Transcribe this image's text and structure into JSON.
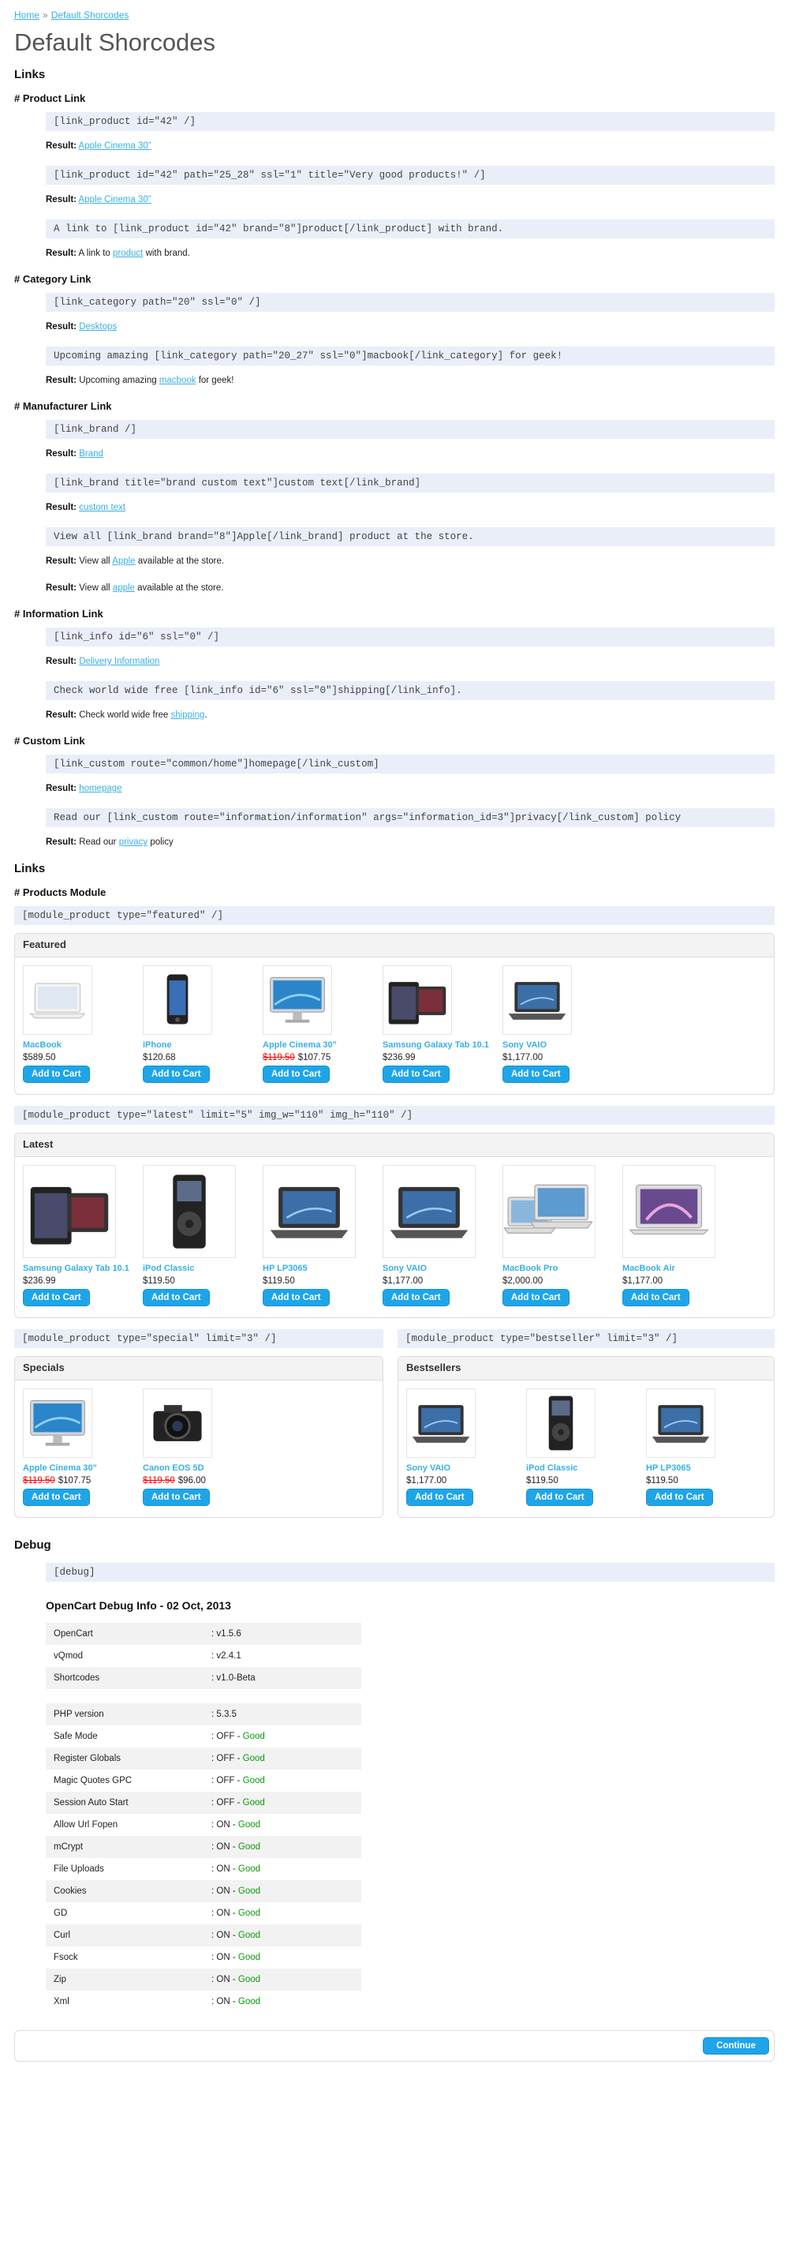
{
  "breadcrumb": {
    "home": "Home",
    "sep": "»",
    "current": "Default Shorcodes"
  },
  "title": "Default Shorcodes",
  "links_heading": "Links",
  "result_label": "Result:",
  "product_link": {
    "heading": "# Product Link",
    "ex1_code": "[link_product id=\"42\" /]",
    "ex1_link": "Apple Cinema 30\"",
    "ex2_code": "[link_product id=\"42\" path=\"25_28\" ssl=\"1\" title=\"Very good products!\" /]",
    "ex2_link": "Apple Cinema 30\"",
    "ex3_code": "A link to [link_product id=\"42\" brand=\"8\"]product[/link_product] with brand.",
    "ex3_pre": "A link to ",
    "ex3_link": "product",
    "ex3_post": " with brand."
  },
  "category_link": {
    "heading": "# Category Link",
    "ex1_code": "[link_category path=\"20\" ssl=\"0\" /]",
    "ex1_link": "Desktops",
    "ex2_code": "Upcoming amazing [link_category path=\"20_27\" ssl=\"0\"]macbook[/link_category] for geek!",
    "ex2_pre": "Upcoming amazing ",
    "ex2_link": "macbook",
    "ex2_post": " for geek!"
  },
  "manufacturer_link": {
    "heading": "# Manufacturer Link",
    "ex1_code": "[link_brand /]",
    "ex1_link": "Brand",
    "ex2_code": "[link_brand title=\"brand custom text\"]custom text[/link_brand]",
    "ex2_link": "custom text",
    "ex3_code": "View all [link_brand brand=\"8\"]Apple[/link_brand] product at the store.",
    "ex3_pre": "View all ",
    "ex3_link": "Apple",
    "ex3_post": " available at the store.",
    "ex4_pre": "View all ",
    "ex4_link": "apple",
    "ex4_post": " available at the store."
  },
  "information_link": {
    "heading": "# Information Link",
    "ex1_code": "[link_info id=\"6\" ssl=\"0\" /]",
    "ex1_link": "Delivery Information",
    "ex2_code": "Check world wide free [link_info id=\"6\" ssl=\"0\"]shipping[/link_info].",
    "ex2_pre": "Check world wide free ",
    "ex2_link": "shipping",
    "ex2_post": "."
  },
  "custom_link": {
    "heading": "# Custom Link",
    "ex1_code": "[link_custom route=\"common/home\"]homepage[/link_custom]",
    "ex1_link": "homepage",
    "ex2_code": "Read our [link_custom route=\"information/information\" args=\"information_id=3\"]privacy[/link_custom] policy",
    "ex2_pre": "Read our ",
    "ex2_link": "privacy",
    "ex2_post": " policy"
  },
  "links2_heading": "Links",
  "products_module_heading": "# Products Module",
  "add_to_cart": "Add to Cart",
  "featured": {
    "code": "[module_product type=\"featured\" /]",
    "title": "Featured",
    "products": [
      {
        "name": "MacBook",
        "price": "$589.50",
        "old": "",
        "icon": "laptop-white"
      },
      {
        "name": "iPhone",
        "price": "$120.68",
        "old": "",
        "icon": "phone"
      },
      {
        "name": "Apple Cinema 30\"",
        "price": "$107.75",
        "old": "$119.50",
        "icon": "monitor"
      },
      {
        "name": "Samsung Galaxy Tab 10.1",
        "price": "$236.99",
        "old": "",
        "icon": "tablet"
      },
      {
        "name": "Sony VAIO",
        "price": "$1,177.00",
        "old": "",
        "icon": "laptop-dark"
      }
    ]
  },
  "latest": {
    "code": "[module_product type=\"latest\" limit=\"5\" img_w=\"110\" img_h=\"110\" /]",
    "title": "Latest",
    "products": [
      {
        "name": "Samsung Galaxy Tab 10.1",
        "price": "$236.99",
        "old": "",
        "icon": "tablet"
      },
      {
        "name": "iPod Classic",
        "price": "$119.50",
        "old": "",
        "icon": "ipod"
      },
      {
        "name": "HP LP3065",
        "price": "$119.50",
        "old": "",
        "icon": "laptop-dark"
      },
      {
        "name": "Sony VAIO",
        "price": "$1,177.00",
        "old": "",
        "icon": "laptop-dark"
      },
      {
        "name": "MacBook Pro",
        "price": "$2,000.00",
        "old": "",
        "icon": "laptop-multi"
      },
      {
        "name": "MacBook Air",
        "price": "$1,177.00",
        "old": "",
        "icon": "laptop-air"
      }
    ]
  },
  "specials": {
    "code": "[module_product type=\"special\" limit=\"3\" /]",
    "title": "Specials",
    "products": [
      {
        "name": "Apple Cinema 30\"",
        "price": "$107.75",
        "old": "$119.50",
        "icon": "monitor"
      },
      {
        "name": "Canon EOS 5D",
        "price": "$96.00",
        "old": "$119.50",
        "icon": "camera"
      }
    ]
  },
  "bestsellers": {
    "code": "[module_product type=\"bestseller\" limit=\"3\" /]",
    "title": "Bestsellers",
    "products": [
      {
        "name": "Sony VAIO",
        "price": "$1,177.00",
        "old": "",
        "icon": "laptop-dark"
      },
      {
        "name": "iPod Classic",
        "price": "$119.50",
        "old": "",
        "icon": "ipod"
      },
      {
        "name": "HP LP3065",
        "price": "$119.50",
        "old": "",
        "icon": "laptop-dark"
      }
    ]
  },
  "debug": {
    "heading": "Debug",
    "code": "[debug]",
    "title": "OpenCart Debug Info - 02 Oct, 2013",
    "versions": [
      {
        "key": "OpenCart",
        "value": ": v1.5.6"
      },
      {
        "key": "vQmod",
        "value": ": v2.4.1"
      },
      {
        "key": "Shortcodes",
        "value": ": v1.0-Beta"
      }
    ],
    "php": {
      "key": "PHP version",
      "value": ": 5.3.5"
    },
    "settings": [
      {
        "key": "Safe Mode",
        "value": ": OFF",
        "status": "Good"
      },
      {
        "key": "Register Globals",
        "value": ": OFF",
        "status": "Good"
      },
      {
        "key": "Magic Quotes GPC",
        "value": ": OFF",
        "status": "Good"
      },
      {
        "key": "Session Auto Start",
        "value": ": OFF",
        "status": "Good"
      },
      {
        "key": "Allow Url Fopen",
        "value": ": ON",
        "status": "Good"
      },
      {
        "key": "mCrypt",
        "value": ": ON",
        "status": "Good"
      },
      {
        "key": "File Uploads",
        "value": ": ON",
        "status": "Good"
      },
      {
        "key": "Cookies",
        "value": ": ON",
        "status": "Good"
      },
      {
        "key": "GD",
        "value": ": ON",
        "status": "Good"
      },
      {
        "key": "Curl",
        "value": ": ON",
        "status": "Good"
      },
      {
        "key": "Fsock",
        "value": ": ON",
        "status": "Good"
      },
      {
        "key": "Zip",
        "value": ": ON",
        "status": "Good"
      },
      {
        "key": "Xml",
        "value": ": ON",
        "status": "Good"
      }
    ],
    "status_sep": " - "
  },
  "continue_button": "Continue",
  "colors": {
    "link": "#38b0e3",
    "button": "#1ea5e8",
    "code_bg": "#e9eef8",
    "good": "#0a9a0a",
    "old_price": "#ff0000"
  }
}
